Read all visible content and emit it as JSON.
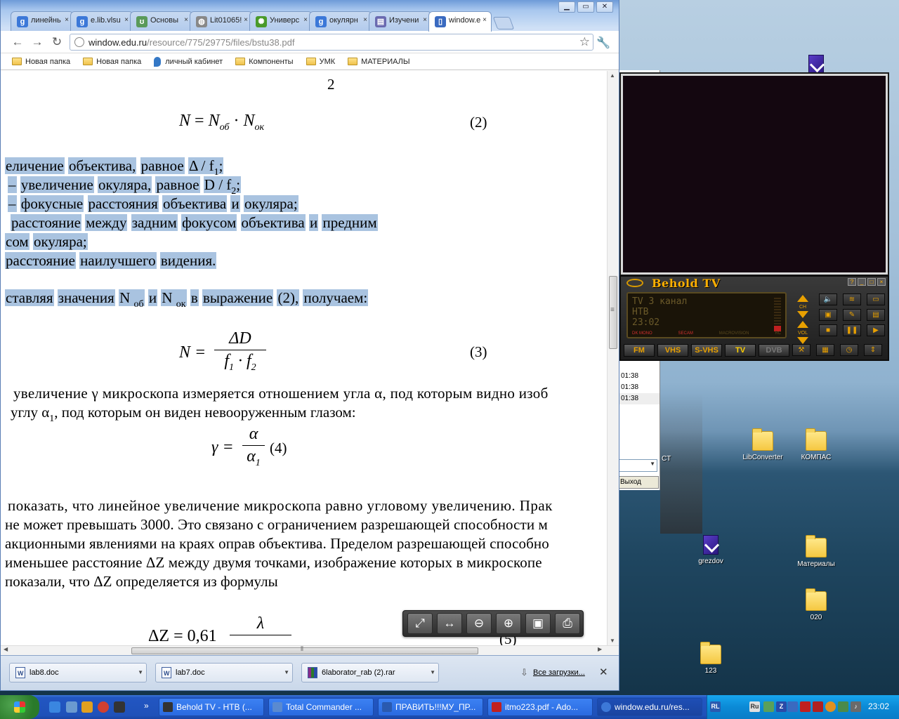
{
  "browser": {
    "tabs": [
      {
        "label": "линейнь",
        "icon": "google-icon",
        "icon_color": "#3c78d8"
      },
      {
        "label": "e.lib.vlsu",
        "icon": "google-icon",
        "icon_color": "#3c78d8"
      },
      {
        "label": "Основы",
        "icon": "site-icon",
        "icon_color": "#5a9a5a"
      },
      {
        "label": "Lit01065!",
        "icon": "globe-icon",
        "icon_color": "#888888"
      },
      {
        "label": "Универс",
        "icon": "sun-icon",
        "icon_color": "#4a9a2a"
      },
      {
        "label": "окулярн",
        "icon": "google-icon",
        "icon_color": "#3c78d8"
      },
      {
        "label": "Изучени",
        "icon": "doc-icon",
        "icon_color": "#6a6ab0"
      },
      {
        "label": "window.e",
        "icon": "book-icon",
        "icon_color": "#3a6ac0"
      }
    ],
    "url_host": "window.edu.ru",
    "url_path": "/resource/775/29775/files/bstu38.pdf",
    "bookmarks": [
      {
        "label": "Новая папка",
        "icon": "folder-icon"
      },
      {
        "label": "Новая папка",
        "icon": "folder-icon"
      },
      {
        "label": "личный кабинет",
        "icon": "pin-icon"
      },
      {
        "label": "Компоненты",
        "icon": "folder-icon"
      },
      {
        "label": "УМК",
        "icon": "folder-icon"
      },
      {
        "label": "МАТЕРИАЛЫ",
        "icon": "folder-icon"
      }
    ],
    "downloads": [
      {
        "label": "lab8.doc",
        "type": "doc"
      },
      {
        "label": "lab7.doc",
        "type": "doc"
      },
      {
        "label": "6laborator_rab (2).rar",
        "type": "rar"
      }
    ],
    "downloads_all": "Все загрузки...",
    "pdf_tools": [
      "fit-page-icon",
      "fit-width-icon",
      "zoom-out-icon",
      "zoom-in-icon",
      "save-icon",
      "print-icon"
    ]
  },
  "document": {
    "page_number": "2",
    "eq2": {
      "lhs": "N",
      "n1": "N",
      "s1": "об",
      "dot": "·",
      "n2": "N",
      "s2": "ок",
      "num": "(2)"
    },
    "defs": [
      {
        "t1": "еличение",
        "t2": "объектива,",
        "t3": "равное",
        "t4": "Δ / f",
        "s": "1",
        "t5": ";"
      },
      {
        "t1": "–",
        "t2": "увеличение",
        "t3": "окуляра,",
        "t4": "равное",
        "t5": "D / f",
        "s": "2",
        "t6": ";"
      },
      {
        "t1": "–",
        "t2": "фокусные",
        "t3": "расстояния",
        "t4": "объектива",
        "t5": "и",
        "t6": "окуляра;"
      },
      {
        "t1": "расстояние",
        "t2": "между",
        "t3": "задним",
        "t4": "фокусом",
        "t5": "объектива",
        "t6": "и",
        "t7": "предним"
      },
      {
        "t1": "сом",
        "t2": "окуляра;"
      },
      {
        "t1": "расстояние",
        "t2": "наилучшего",
        "t3": "видения."
      }
    ],
    "subst": {
      "t1": "ставляя",
      "t2": "значения",
      "t3": "N",
      "s1": "об",
      "t4": "и",
      "t5": "N",
      "s2": "ок",
      "t6": "в",
      "t7": "выражение",
      "t8": "(2),",
      "t9": "получаем:"
    },
    "eq3": {
      "lhs": "N =",
      "num": "ΔD",
      "den_a": "f",
      "den_s1": "1",
      "den_dot": " · ",
      "den_b": "f",
      "den_s2": "2",
      "no": "(3)"
    },
    "p1": "увеличение γ микроскопа измеряется отношением угла α, под которым видно изоб",
    "p2a": "углу α",
    "p2s": "1",
    "p2b": ", под которым  он виден невооруженным глазом:",
    "eq4": {
      "lhs": "γ =",
      "num": "α",
      "den": "α",
      "den_s": "1",
      "no": "(4)"
    },
    "p3": [
      "показать, что линейное увеличение микроскопа равно угловому увеличению. Прак",
      "не может превышать 3000. Это связано с ограничением разрешающей способности м",
      "акционными явлениями на краях оправ объектива. Пределом разрешающей способно",
      "именьшее расстояние ΔZ между двумя точками, изображение которых в микроскопе",
      "показали, что ΔZ определяется из формулы"
    ],
    "eq5": {
      "lhs": "ΔZ = 0,61",
      "num": "λ",
      "no": "(5)"
    }
  },
  "behold": {
    "title": "Behold TV",
    "lcd_lines": [
      "TV  3 канал",
      "НТВ",
      "23:02"
    ],
    "lcd_foot": [
      "DK MONO",
      "SECAM",
      "MACROVISION",
      "RC"
    ],
    "ch_label": "CH",
    "vol_label": "VOL",
    "modes": [
      "FM",
      "VHS",
      "S-VHS",
      "TV",
      "DVB"
    ]
  },
  "total_commander": {
    "times": [
      "01:38",
      "01:38",
      "01:38"
    ],
    "exit_label": "Выход"
  },
  "desktop_icons": [
    {
      "label": "LibConverter",
      "icon": "folder-icon"
    },
    {
      "label": "КОМПАС",
      "icon": "folder-icon"
    },
    {
      "label": "grezdov",
      "icon": "document-icon"
    },
    {
      "label": "Материалы",
      "icon": "folder-icon"
    },
    {
      "label": "020",
      "icon": "folder-icon"
    },
    {
      "label": "123",
      "icon": "folder-icon"
    },
    {
      "label": "CT",
      "icon": "folder-icon"
    }
  ],
  "taskbar": {
    "tasks": [
      {
        "label": "Behold TV - НТВ (...",
        "color": "#333333"
      },
      {
        "label": "Total Commander ...",
        "color": "#5a8ad0"
      },
      {
        "label": "ПРАВИТЬ!!!МУ_ПР...",
        "color": "#2a5ab0"
      },
      {
        "label": "itmo223.pdf - Ado...",
        "color": "#c02020"
      },
      {
        "label": "window.edu.ru/res...",
        "color": "#3c78d8"
      }
    ],
    "lang": "Ru",
    "lang_rl": "RL",
    "clock": "23:02"
  }
}
